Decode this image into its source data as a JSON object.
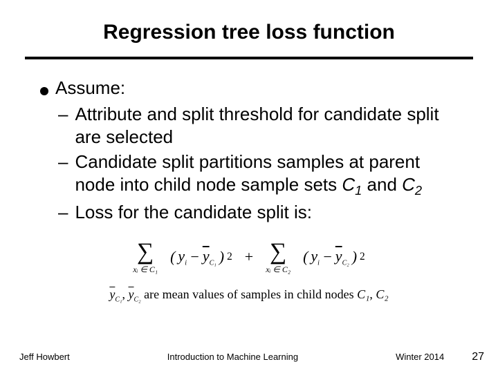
{
  "title": "Regression tree loss function",
  "body": {
    "lead": "Assume:",
    "items": [
      {
        "text_pre": "Attribute and split threshold for candidate split are selected"
      },
      {
        "text_pre": "Candidate split partitions samples at parent node into child node sample sets ",
        "c1": "C",
        "s1": "1",
        "mid": " and ",
        "c2": "C",
        "s2": "2"
      },
      {
        "text_pre": "Loss for the candidate split is:"
      }
    ]
  },
  "formula": {
    "sigma": "∑",
    "sumsub1": "xᵢ ∈ C₁",
    "sumsub2": "xᵢ ∈ C₂",
    "open": "(",
    "close": ")",
    "yi": "y",
    "yisub": "i",
    "minus": "−",
    "ybar": "y",
    "ybarsub1": "C₁",
    "ybarsub2": "C₂",
    "sq": "2",
    "plus": "+"
  },
  "note": {
    "ybar": "y",
    "s1": "C₁",
    "comma": ", ",
    "s2": "C₂",
    "rest": " are mean values of samples in child nodes ",
    "c1": "C₁",
    "c2": "C₂"
  },
  "footer": {
    "author": "Jeff Howbert",
    "course": "Introduction to Machine Learning",
    "term": "Winter 2014",
    "page": "27"
  }
}
